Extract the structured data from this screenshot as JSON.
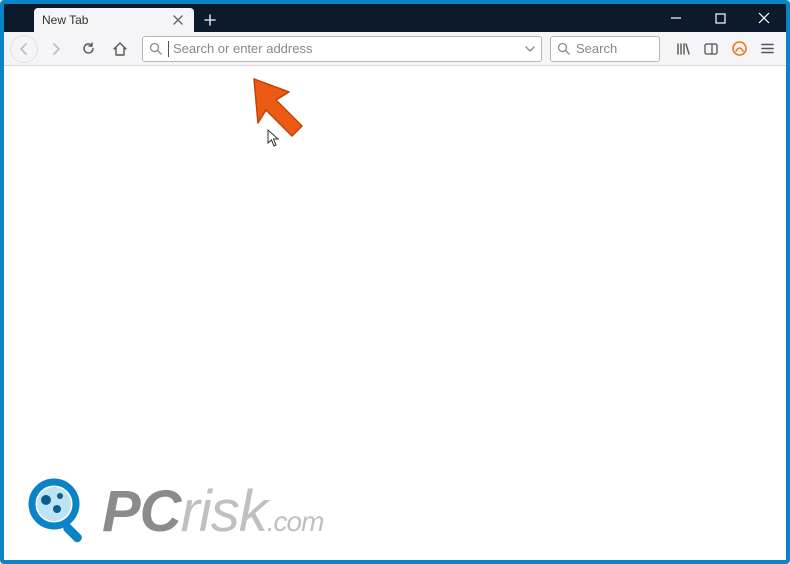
{
  "tab": {
    "title": "New Tab"
  },
  "address": {
    "placeholder": "Search or enter address",
    "value": ""
  },
  "search": {
    "placeholder": "Search",
    "value": ""
  },
  "watermark": {
    "pc": "PC",
    "risk": "risk",
    "dotcom": ".com"
  }
}
